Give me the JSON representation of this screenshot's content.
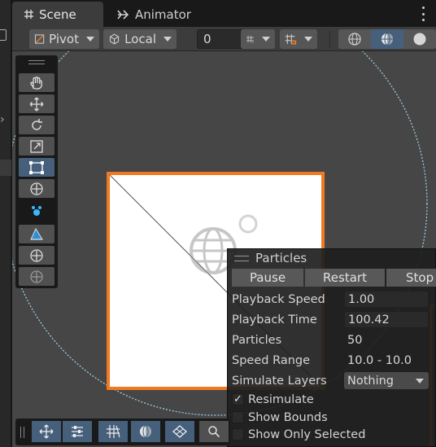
{
  "tabs": {
    "scene_label": "Scene",
    "animator_label": "Animator"
  },
  "toolbar": {
    "pivot_label": "Pivot",
    "local_label": "Local",
    "zoom_value": "0"
  },
  "particles": {
    "title": "Particles",
    "buttons": [
      "Pause",
      "Restart",
      "Stop"
    ],
    "rows": [
      {
        "label": "Playback Speed",
        "value": "1.00"
      },
      {
        "label": "Playback Time",
        "value": "100.42"
      },
      {
        "label": "Particles",
        "value": "50"
      },
      {
        "label": "Speed Range",
        "value": "10.0 - 10.0"
      },
      {
        "label": "Simulate Layers",
        "value": "Nothing"
      }
    ],
    "checks": [
      {
        "label": "Resimulate",
        "checked": true
      },
      {
        "label": "Show Bounds",
        "checked": false
      },
      {
        "label": "Show Only Selected",
        "checked": false
      }
    ]
  },
  "colors": {
    "selection_outline": "#f07a22",
    "active_tool": "#46607c",
    "scene_background": "#464646"
  }
}
